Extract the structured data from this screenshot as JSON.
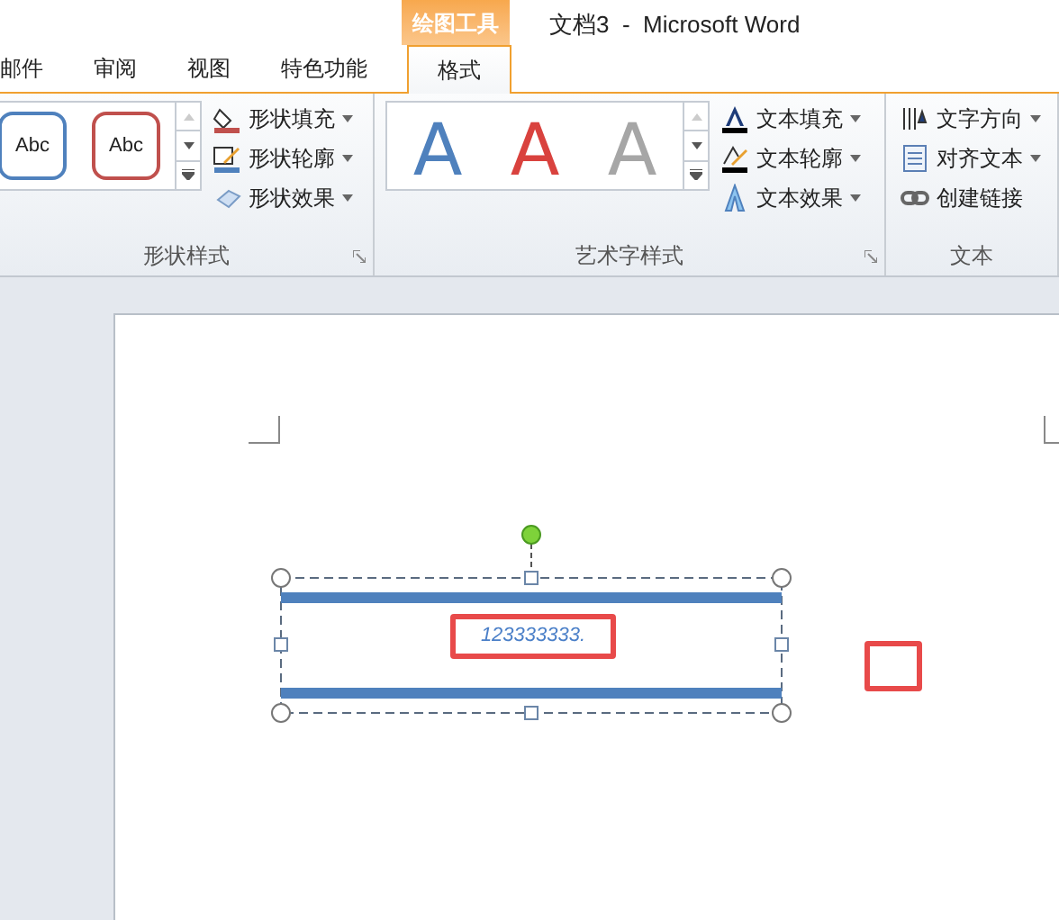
{
  "title_bar": {
    "context_group": "绘图工具",
    "title": "文档3  -  Microsoft Word"
  },
  "tabs": [
    {
      "label": "邮件",
      "selected": false
    },
    {
      "label": "审阅",
      "selected": false
    },
    {
      "label": "视图",
      "selected": false
    },
    {
      "label": "特色功能",
      "selected": false
    },
    {
      "label": "格式",
      "selected": true
    }
  ],
  "groups": [
    {
      "title": "形状样式",
      "gallery": [
        {
          "label": "Abc",
          "color": "#4f81bd"
        },
        {
          "label": "Abc",
          "color": "#c0504d"
        }
      ],
      "commands": [
        {
          "label": "形状填充",
          "dropdown": true
        },
        {
          "label": "形状轮廓",
          "dropdown": true
        },
        {
          "label": "形状效果",
          "dropdown": true
        }
      ]
    },
    {
      "title": "艺术字样式",
      "gallery": [
        {
          "label": "A",
          "color": "#4f81bd"
        },
        {
          "label": "A",
          "color": "#d9423e"
        },
        {
          "label": "A",
          "color": "#a6a6a6"
        }
      ],
      "commands": [
        {
          "label": "文本填充",
          "dropdown": true
        },
        {
          "label": "文本轮廓",
          "dropdown": true
        },
        {
          "label": "文本效果",
          "dropdown": true
        }
      ]
    },
    {
      "title": "文本",
      "commands": [
        {
          "label": "文字方向",
          "dropdown": true
        },
        {
          "label": "对齐文本",
          "dropdown": true
        },
        {
          "label": "创建链接",
          "dropdown": false
        }
      ]
    }
  ],
  "document": {
    "shape_text": "123333333."
  }
}
